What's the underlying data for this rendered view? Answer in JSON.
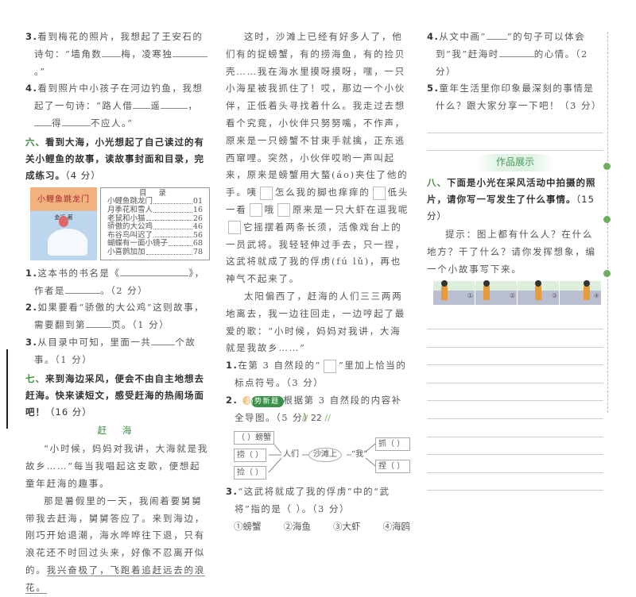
{
  "left": {
    "q3": {
      "num": "3.",
      "parts": [
        "看到梅花的照片，我想起了王安石的诗句：“墙角数",
        24,
        "梅，凌寒独",
        44,
        "。”"
      ]
    },
    "q4": {
      "num": "4.",
      "parts": [
        "看到照片中小孩子在河边钓鱼，我想起了一句诗：“路人借",
        22,
        "遥",
        34,
        "，",
        22,
        "得",
        36,
        "不应人。”"
      ]
    },
    "sec6": {
      "mark": "六、",
      "text": "看到大海，小光想起了自己读过的有关小鲤鱼的故事，读故事封面和目录，完成练习。",
      "score": "（4 分）"
    },
    "book": {
      "cover_title": "小鲤鱼跳龙门",
      "author": "金近 著",
      "toc_heading": "目 录",
      "toc": [
        {
          "t": "小鲤鱼跳龙门",
          "p": "01"
        },
        {
          "t": "月季花和雪人",
          "p": "16"
        },
        {
          "t": "老鼠和小猫",
          "p": "26"
        },
        {
          "t": "骄傲的大公鸡",
          "p": "46"
        },
        {
          "t": "布谷鸟叫迟了",
          "p": "56"
        },
        {
          "t": "蝴蝶有一面小镜子",
          "p": "68"
        },
        {
          "t": "小喜鹊加加",
          "p": "78"
        }
      ]
    },
    "s6q1": {
      "num": "1.",
      "parts": [
        "这本书的书名是《",
        86,
        "》，作者是",
        44,
        "。（2 分）"
      ]
    },
    "s6q2": {
      "num": "2.",
      "parts": [
        "如果要看“骄傲的大公鸡”这则故事，需要翻到第",
        32,
        "页。（1 分）"
      ]
    },
    "s6q3": {
      "num": "3.",
      "parts": [
        "从目录中可知，里面一共",
        30,
        "个故事。（1 分）"
      ]
    },
    "sec7": {
      "mark": "七、",
      "text": "来到海边采风，便会不由自主地想去赶海。快来读短文，感受赶海的热闹场面吧！",
      "score": "（16 分）"
    },
    "story_title": "赶  海",
    "p1": "“小时候，妈妈对我讲，大海就是我故乡……”每当我唱起这支歌，便想起童年赶海的趣事。",
    "p2a": "那是暑假里的一天，我闹着要舅舅带我去赶海，舅舅答应了。来到海边，刚巧开始退潮，海水哗哗往下退，只有浪花还不时回过头来，好像不忍离开似的。",
    "p2b": "我兴奋极了，飞跑着追赶远去的浪花。"
  },
  "mid": {
    "p3a": "这时，沙滩上已经有好多人了，他们有的捉螃蟹，有的捞海鱼，有的捡贝壳……我在海水里摸呀摸呀，嘿，一只小海星被我抓住了！哎，那边一个小伙伴，正低着头寻找着什么。我走过去想看个究竟，小伙伴只努努嘴，不作声，原来是一只螃蟹不甘束手就擒，正东逃西窜哩。突然，小伙伴哎哟一声叫起来，原来是螃蟹用大螯(áo)夹住了他的手。咦",
    "p3b": "怎么我的脚也痒痒的",
    "p3c": "低头一看",
    "p3d": "哦",
    "p3e": "原来是一只大虾在逗我呢",
    "p3f": "它摇摆着两条长须，活像戏台上的一员武将。我轻轻伸过手去，只一捏，这武将就成了我的俘虏(fú lǔ)，再也神气不起来了。",
    "p4": "太阳偏西了，赶海的人们三三两两地离去，我一边往回走，一边哼起了最爱的歌：“小时候，妈妈对我讲，大海就是我故乡……”",
    "q1": {
      "num": "1.",
      "a": "在第 3 自然段的“",
      "b": "”里加上恰当的标点符号。（3 分）"
    },
    "q2": {
      "num": "2.",
      "tag": "趋势新题",
      "text": "根据第 3 自然段的内容补全导图。（5 分）"
    },
    "map": {
      "b1": "（    ）螃蟹",
      "b2": "捞（        ）",
      "b3": "捡（        ）",
      "people": "人们",
      "beach": "沙滩上",
      "me": "“我”",
      "b4": "抓（        ）",
      "b5": "捏（        ）"
    },
    "q3": {
      "num": "3.",
      "text": "“这武将就成了我的俘虏”中的“武将”指的是（    ）。（3 分）"
    },
    "options": [
      "①螃蟹",
      "②海鱼",
      "③大虾",
      "④海鸥"
    ]
  },
  "right": {
    "q4": {
      "num": "4.",
      "parts": [
        "从文中画“",
        26,
        "”的句子可以体会到“我”赶海时",
        44,
        "的心情。（2 分）"
      ]
    },
    "q5": {
      "num": "5.",
      "text": "童年生活里你印象最深刻的事情是什么？跟大家分享一下吧！（3 分）"
    },
    "showcase": "作品展示",
    "sec8": {
      "mark": "八、",
      "text": "下面是小光在采风活动中拍摄的照片，请你写一写发生了什么事情。",
      "score": "（15 分）"
    },
    "hint": "提示：图上都有什么人？在什么地方？干了什么？请你发挥想象，编一个小故事写下来。",
    "photo_nums": [
      "①",
      "②",
      "③",
      "④"
    ]
  },
  "page_number": "22",
  "colors": {
    "section_green": "#3c8a3c",
    "tag_green": "#3a8f4a"
  }
}
